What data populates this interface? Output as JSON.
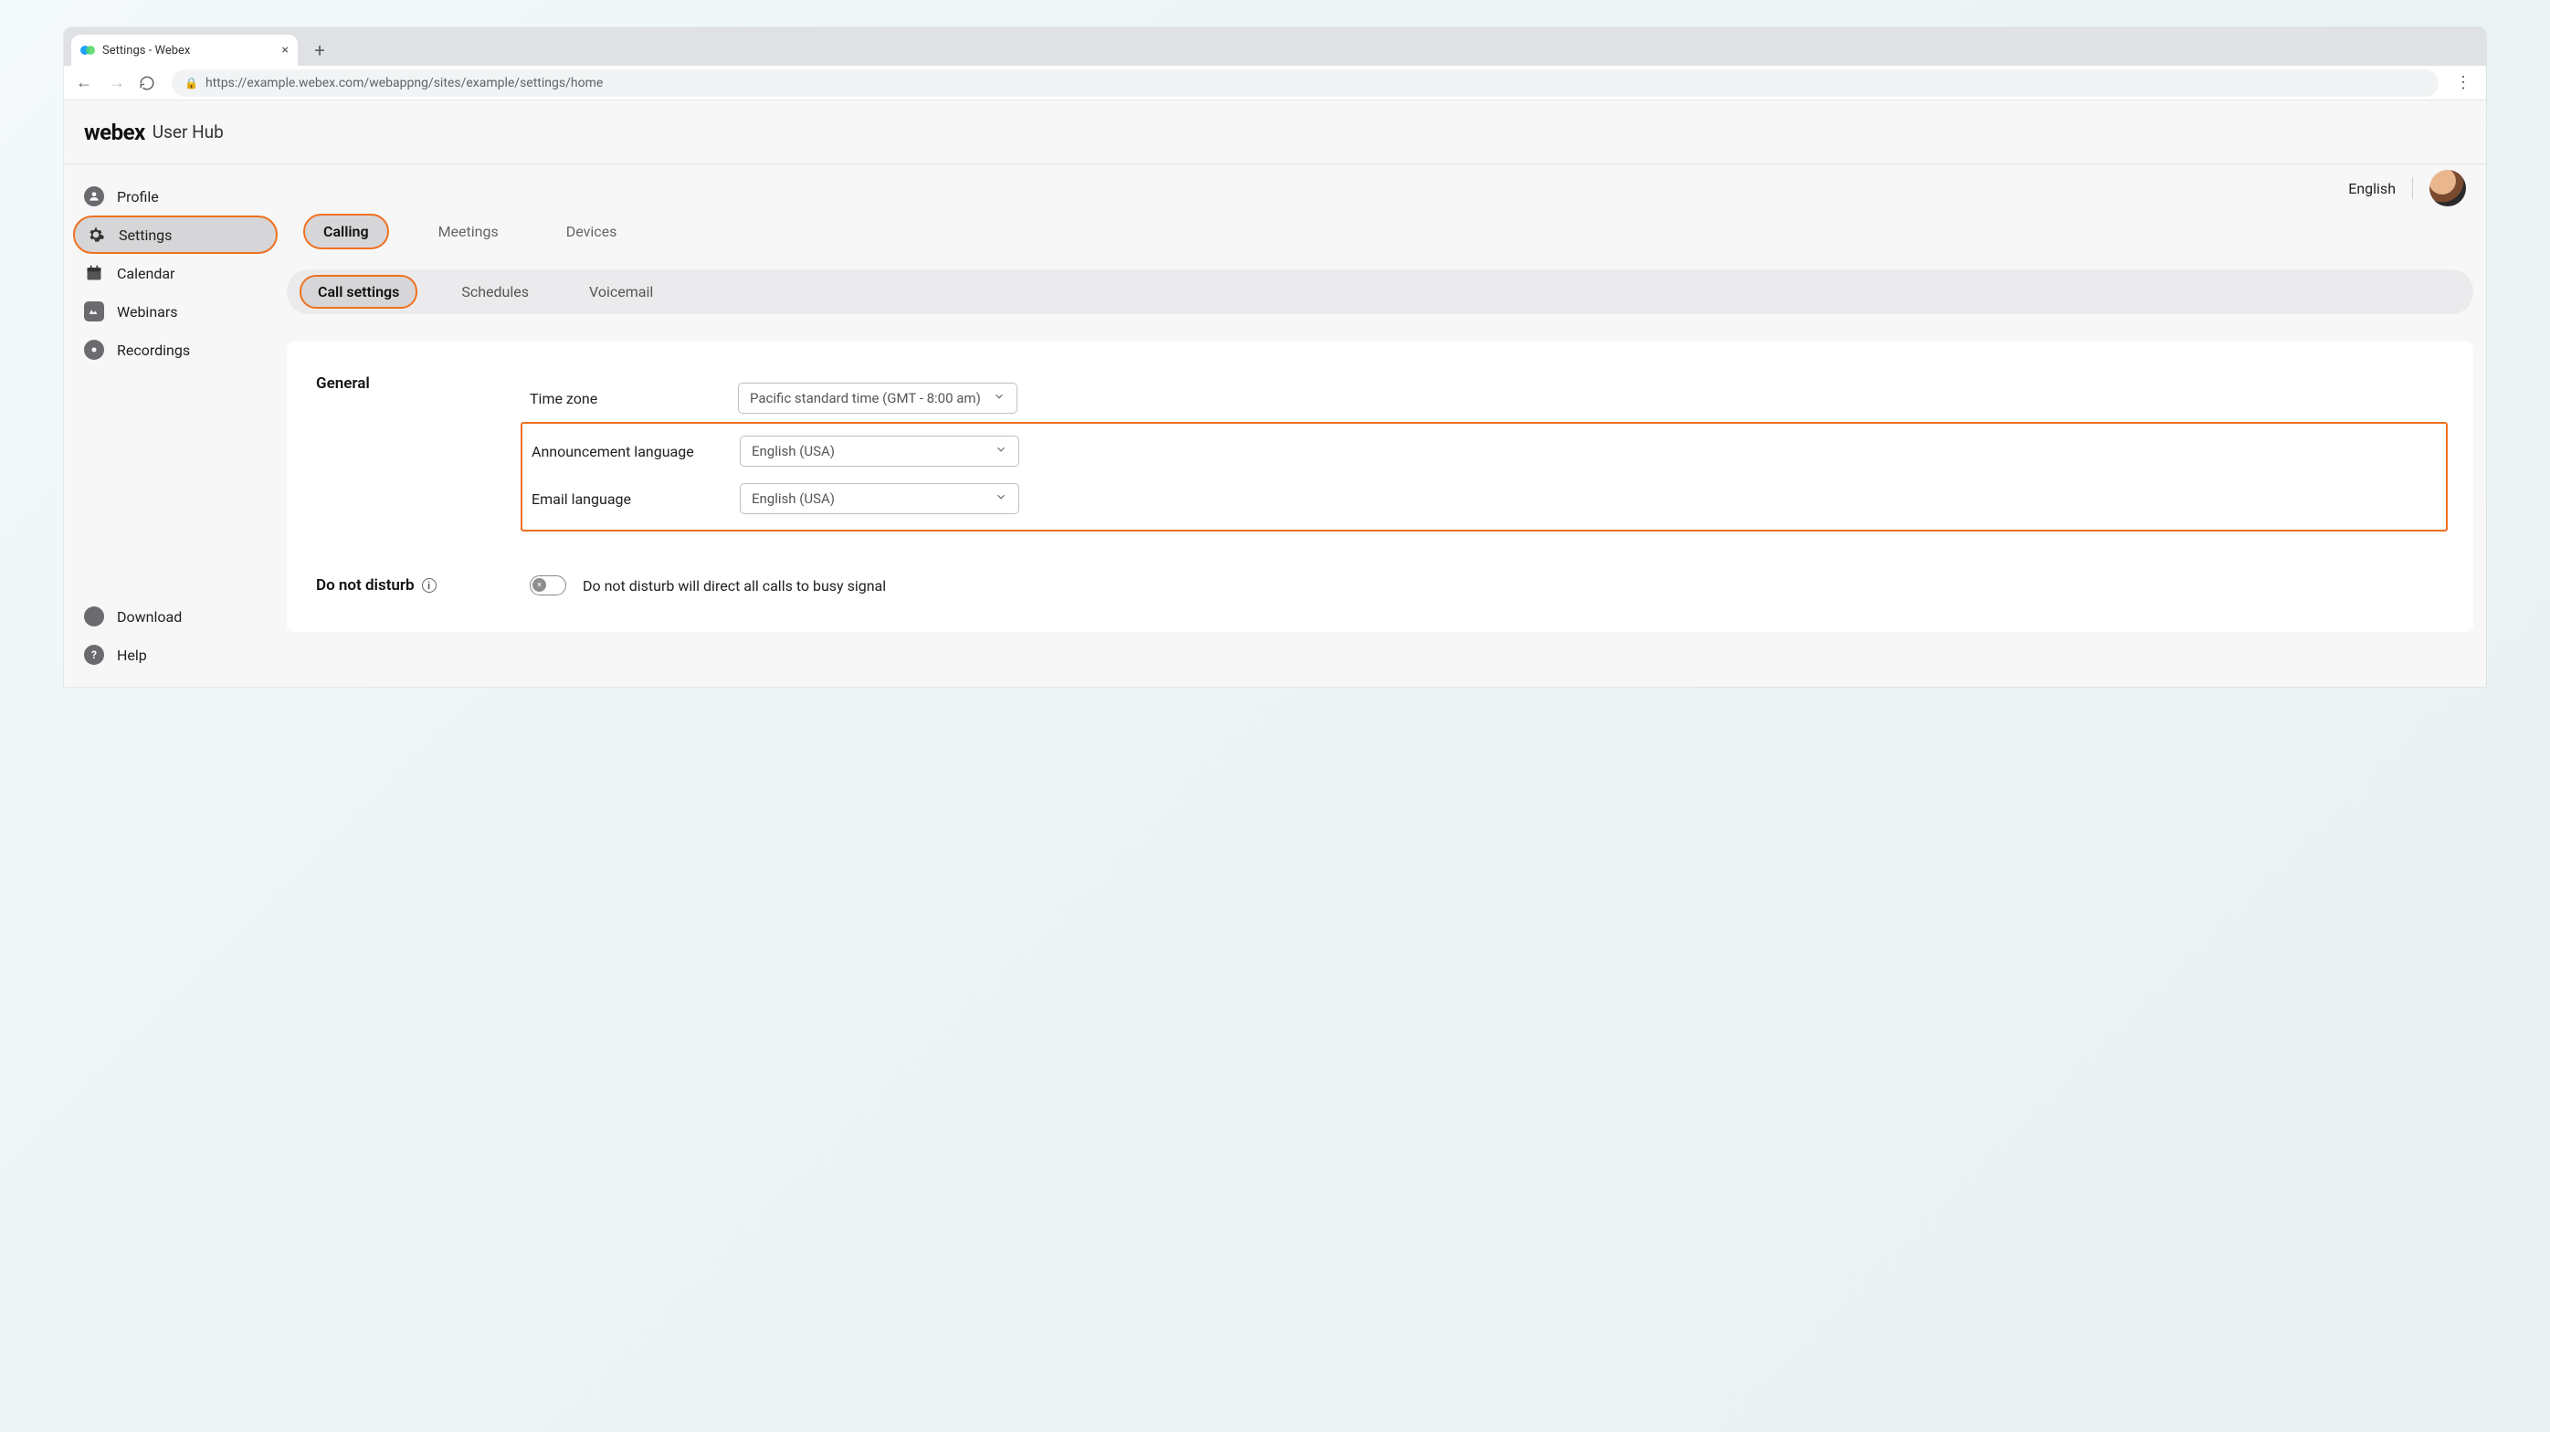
{
  "browser": {
    "tab_title": "Settings - Webex",
    "url": "https://example.webex.com/webappng/sites/example/settings/home"
  },
  "header": {
    "brand": "webex",
    "product": "User Hub"
  },
  "topright": {
    "language": "English"
  },
  "sidebar": {
    "items": [
      {
        "label": "Profile"
      },
      {
        "label": "Settings"
      },
      {
        "label": "Calendar"
      },
      {
        "label": "Webinars"
      },
      {
        "label": "Recordings"
      }
    ],
    "footer": [
      {
        "label": "Download"
      },
      {
        "label": "Help"
      }
    ]
  },
  "tabs": {
    "primary": [
      {
        "label": "Calling"
      },
      {
        "label": "Meetings"
      },
      {
        "label": "Devices"
      }
    ],
    "secondary": [
      {
        "label": "Call settings"
      },
      {
        "label": "Schedules"
      },
      {
        "label": "Voicemail"
      }
    ]
  },
  "general": {
    "section_title": "General",
    "time_zone_label": "Time zone",
    "time_zone_value": "Pacific standard time (GMT - 8:00 am)",
    "announcement_label": "Announcement language",
    "announcement_value": "English (USA)",
    "email_label": "Email language",
    "email_value": "English (USA)"
  },
  "dnd": {
    "title": "Do not disturb",
    "description": "Do not disturb will direct all calls to busy signal",
    "enabled": false
  }
}
